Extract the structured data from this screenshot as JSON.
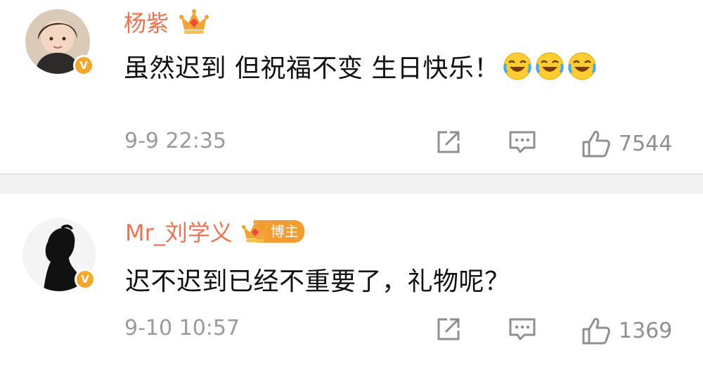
{
  "comments": [
    {
      "username": "杨紫",
      "text": "虽然迟到 但祝福不变 生日快乐！",
      "time": "9-9 22:35",
      "likes": "7544",
      "emoji_count": 3,
      "badge": "V"
    },
    {
      "username": "Mr_刘学义",
      "vip_tag": "博主",
      "text": "迟不迟到已经不重要了，礼物呢？",
      "time": "9-10 10:57",
      "likes": "1369",
      "badge": "V"
    }
  ],
  "icons": {
    "share": "share-icon",
    "reply": "comment-icon",
    "like": "thumbs-up-icon",
    "crown": "crown-icon",
    "emoji": "laugh-cry-emoji"
  },
  "colors": {
    "username": "#eb7350",
    "verified": "#f4a72b",
    "meta": "#9a9a9a",
    "divider": "#f2f2f2"
  }
}
